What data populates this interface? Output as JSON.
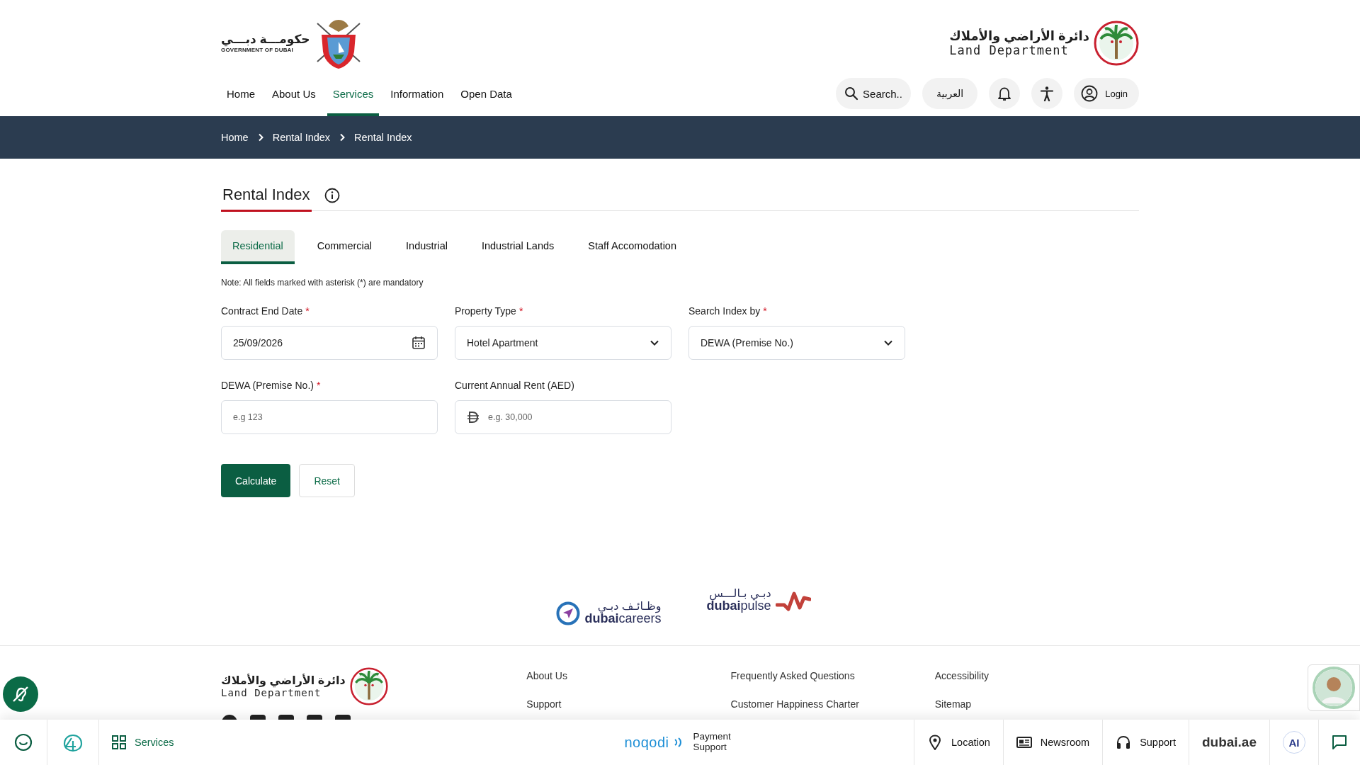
{
  "header": {
    "gov_logo": {
      "arabic": "حكومـــة دبـــي",
      "english": "GOVERNMENT OF DUBAI"
    },
    "dld_logo": {
      "arabic": "دائرة الأراضي والأملاك",
      "english": "Land Department"
    }
  },
  "nav": [
    {
      "label": "Home",
      "selected": false
    },
    {
      "label": "About Us",
      "selected": false
    },
    {
      "label": "Services",
      "selected": true
    },
    {
      "label": "Information",
      "selected": false
    },
    {
      "label": "Open Data",
      "selected": false
    }
  ],
  "tools": {
    "search": "Search..",
    "language": "العربية",
    "login": "Login"
  },
  "breadcrumb": [
    "Home",
    "Rental Index",
    "Rental Index"
  ],
  "page_title": "Rental Index",
  "tabs": [
    {
      "label": "Residential",
      "selected": true
    },
    {
      "label": "Commercial",
      "selected": false
    },
    {
      "label": "Industrial",
      "selected": false
    },
    {
      "label": "Industrial Lands",
      "selected": false
    },
    {
      "label": "Staff Accomodation",
      "selected": false
    }
  ],
  "note": "Note: All fields marked with asterisk (*) are mandatory",
  "required_mark": "*",
  "fields": [
    {
      "kind": "date",
      "label": "Contract End Date",
      "required": true,
      "value": "25/09/2026"
    },
    {
      "kind": "select",
      "label": "Property Type",
      "required": true,
      "value": "Hotel Apartment"
    },
    {
      "kind": "select",
      "label": "Search Index by",
      "required": true,
      "value": "DEWA (Premise No.)"
    },
    {
      "kind": "text",
      "label": "DEWA (Premise No.)",
      "required": true,
      "placeholder": "e.g 123"
    },
    {
      "kind": "currency",
      "label": "Current Annual Rent (AED)",
      "required": false,
      "placeholder": "e.g. 30,000"
    }
  ],
  "buttons": [
    {
      "kind": "primary",
      "label": "Calculate"
    },
    {
      "kind": "secondary",
      "label": "Reset"
    }
  ],
  "partners": [
    {
      "kind": "careers",
      "arabic": "وظـائـف دبـي",
      "bold": "dubai",
      "rest": "careers"
    },
    {
      "kind": "pulse",
      "arabic": "دبـي بـالـــس",
      "bold": "dubai",
      "rest": "pulse"
    }
  ],
  "footer": {
    "logo": {
      "arabic": "دائرة الأراضي والأملاك",
      "english": "Land Department"
    },
    "link_columns": [
      [
        "About Us",
        "Support"
      ],
      [
        "Frequently Asked Questions",
        "Customer Happiness Charter"
      ],
      [
        "Accessibility",
        "Sitemap"
      ]
    ]
  },
  "bottom_bar": {
    "services": "Services",
    "payment": {
      "brand": "noqodi",
      "label": "Payment Support"
    },
    "right": [
      {
        "kind": "location",
        "label": "Location"
      },
      {
        "kind": "newsroom",
        "label": "Newsroom"
      },
      {
        "kind": "support",
        "label": "Support"
      }
    ],
    "portal": "dubai.ae",
    "ai": "AI"
  }
}
